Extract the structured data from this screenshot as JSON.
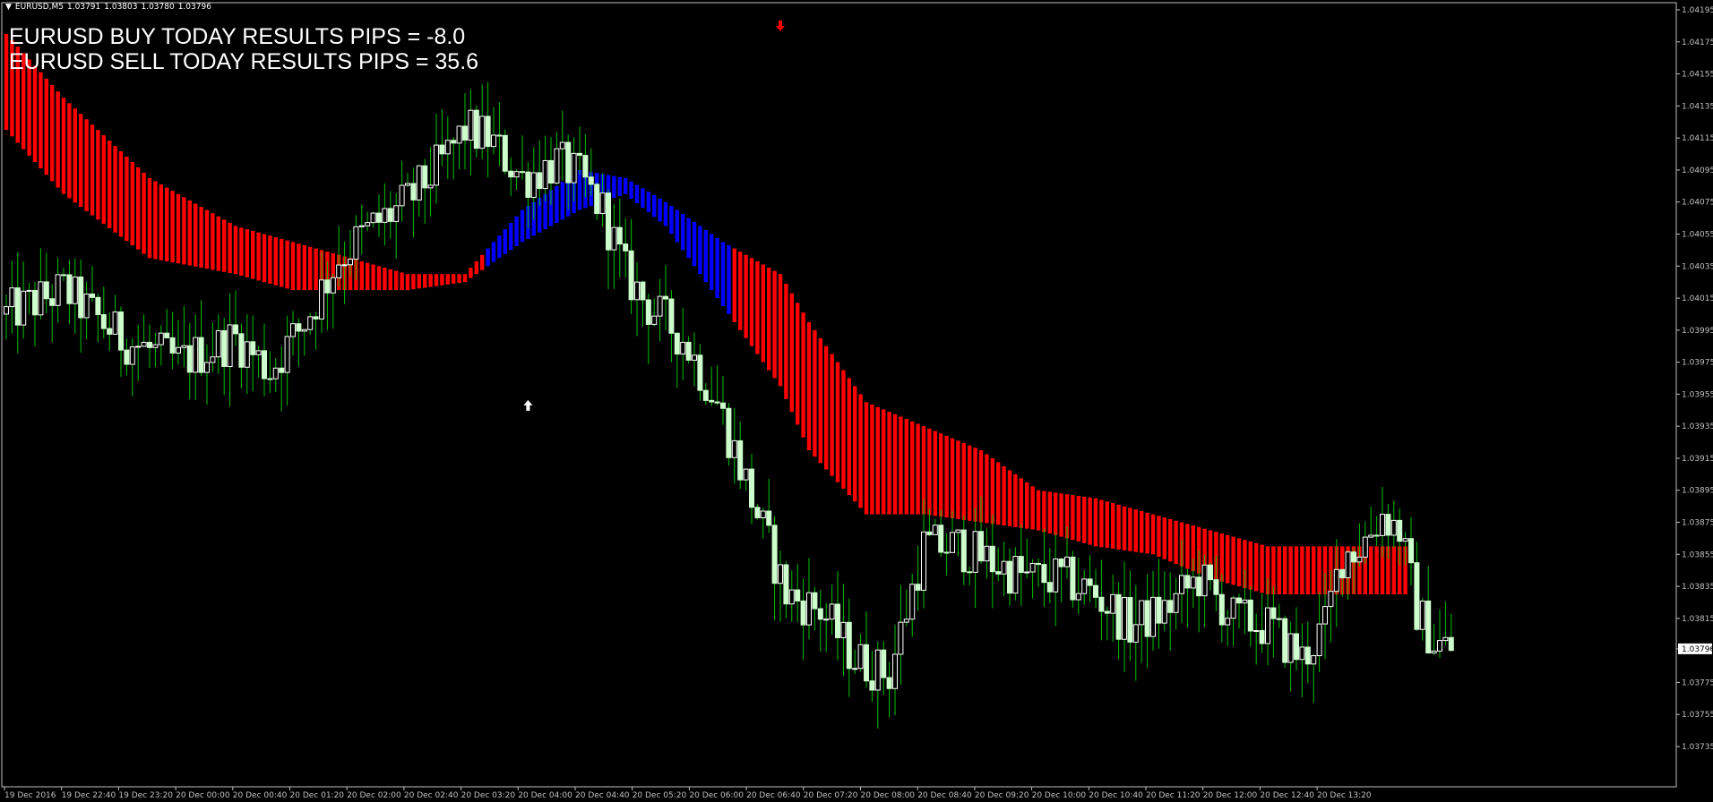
{
  "chart_header": {
    "symbol_period": "EURUSD,M5",
    "ohlc": [
      "1.03791",
      "1.03803",
      "1.03780",
      "1.03796"
    ]
  },
  "overlay_text": {
    "buy_results": "EURUSD BUY TODAY RESULTS PIPS = -8.0",
    "sell_results": "EURUSD SELL TODAY RESULTS PIPS = 35.6"
  },
  "current_price": "1.03796",
  "colors": {
    "background": "#000000",
    "frame": "#c0c0c0",
    "bull_candle": "#ffffff",
    "bear_candle": "#ccffcc",
    "wick": "#00c000",
    "ribbon_sell": "#ff0000",
    "ribbon_buy": "#0000ff",
    "buy_arrow": "#ffffff",
    "sell_arrow": "#ff0000"
  },
  "chart_data": {
    "type": "candlestick",
    "timeframe": "M5",
    "y_axis": {
      "range": [
        1.0373,
        1.0419
      ],
      "tick_labels": [
        "1.04195",
        "1.04175",
        "1.04155",
        "1.04135",
        "1.04115",
        "1.04095",
        "1.04075",
        "1.04055",
        "1.04035",
        "1.04015",
        "1.03995",
        "1.03975",
        "1.03955",
        "1.03935",
        "1.03915",
        "1.03895",
        "1.03875",
        "1.03855",
        "1.03835",
        "1.03815",
        "1.03796",
        "1.03775",
        "1.03755",
        "1.03735"
      ]
    },
    "x_axis": {
      "tick_labels": [
        "19 Dec 2016",
        "19 Dec 22:40",
        "19 Dec 23:20",
        "20 Dec 00:00",
        "20 Dec 00:40",
        "20 Dec 01:20",
        "20 Dec 02:00",
        "20 Dec 02:40",
        "20 Dec 03:20",
        "20 Dec 04:00",
        "20 Dec 04:40",
        "20 Dec 05:20",
        "20 Dec 06:00",
        "20 Dec 06:40",
        "20 Dec 07:20",
        "20 Dec 08:00",
        "20 Dec 08:40",
        "20 Dec 09:20",
        "20 Dec 10:00",
        "20 Dec 10:40",
        "20 Dec 11:20",
        "20 Dec 12:00",
        "20 Dec 12:40",
        "20 Dec 13:20"
      ]
    },
    "price_path": [
      [
        0,
        1.04005
      ],
      [
        10,
        1.0402
      ],
      [
        20,
        1.0399
      ],
      [
        30,
        1.03975
      ],
      [
        40,
        1.0399
      ],
      [
        46,
        1.0397
      ],
      [
        52,
        1.04
      ],
      [
        58,
        1.0404
      ],
      [
        64,
        1.0406
      ],
      [
        70,
        1.04075
      ],
      [
        76,
        1.041
      ],
      [
        80,
        1.0412
      ],
      [
        84,
        1.04115
      ],
      [
        90,
        1.0409
      ],
      [
        96,
        1.041
      ],
      [
        100,
        1.0409
      ],
      [
        104,
        1.0407
      ],
      [
        108,
        1.0403
      ],
      [
        112,
        1.0401
      ],
      [
        118,
        1.0399
      ],
      [
        124,
        1.0395
      ],
      [
        130,
        1.0389
      ],
      [
        136,
        1.0383
      ],
      [
        142,
        1.0382
      ],
      [
        148,
        1.0379
      ],
      [
        154,
        1.0378
      ],
      [
        160,
        1.0386
      ],
      [
        166,
        1.0386
      ],
      [
        172,
        1.0385
      ],
      [
        178,
        1.0384
      ],
      [
        184,
        1.0384
      ],
      [
        190,
        1.0383
      ],
      [
        196,
        1.0381
      ],
      [
        202,
        1.0382
      ],
      [
        208,
        1.0384
      ],
      [
        214,
        1.03815
      ],
      [
        220,
        1.0381
      ],
      [
        226,
        1.0379
      ],
      [
        230,
        1.0381
      ],
      [
        233,
        1.03855
      ],
      [
        236,
        1.0386
      ],
      [
        240,
        1.0388
      ],
      [
        243,
        1.0387
      ],
      [
        246,
        1.0382
      ],
      [
        249,
        1.038
      ],
      [
        252,
        1.03796
      ]
    ],
    "ribbon_path": [
      [
        0,
        1.0418,
        1.0412
      ],
      [
        10,
        1.0414,
        1.0408
      ],
      [
        25,
        1.0409,
        1.0404
      ],
      [
        40,
        1.0406,
        1.0403
      ],
      [
        50,
        1.0405,
        1.0402
      ],
      [
        60,
        1.0404,
        1.0402
      ],
      [
        70,
        1.0403,
        1.0402
      ],
      [
        80,
        1.0403,
        1.04025
      ],
      [
        90,
        1.0407,
        1.0405
      ],
      [
        100,
        1.04095,
        1.0407
      ],
      [
        108,
        1.0409,
        1.0408
      ],
      [
        115,
        1.04075,
        1.0406
      ],
      [
        125,
        1.0405,
        1.0401
      ],
      [
        135,
        1.0403,
        1.0396
      ],
      [
        140,
        1.04,
        1.0392
      ],
      [
        150,
        1.0395,
        1.0388
      ],
      [
        160,
        1.03935,
        1.0388
      ],
      [
        170,
        1.0392,
        1.03875
      ],
      [
        180,
        1.03895,
        1.0387
      ],
      [
        190,
        1.0389,
        1.0386
      ],
      [
        200,
        1.0388,
        1.03855
      ],
      [
        210,
        1.0387,
        1.0384
      ],
      [
        220,
        1.0386,
        1.0383
      ],
      [
        230,
        1.0386,
        1.0383
      ],
      [
        240,
        1.0386,
        1.0383
      ],
      [
        244,
        1.0386,
        1.0383
      ]
    ],
    "ribbon_buy_range": [
      84,
      126
    ],
    "bar_count": 253,
    "signals": [
      {
        "type": "buy",
        "bar": 91,
        "price": 1.03948
      },
      {
        "type": "sell",
        "bar": 135,
        "price": 1.04185
      }
    ]
  }
}
